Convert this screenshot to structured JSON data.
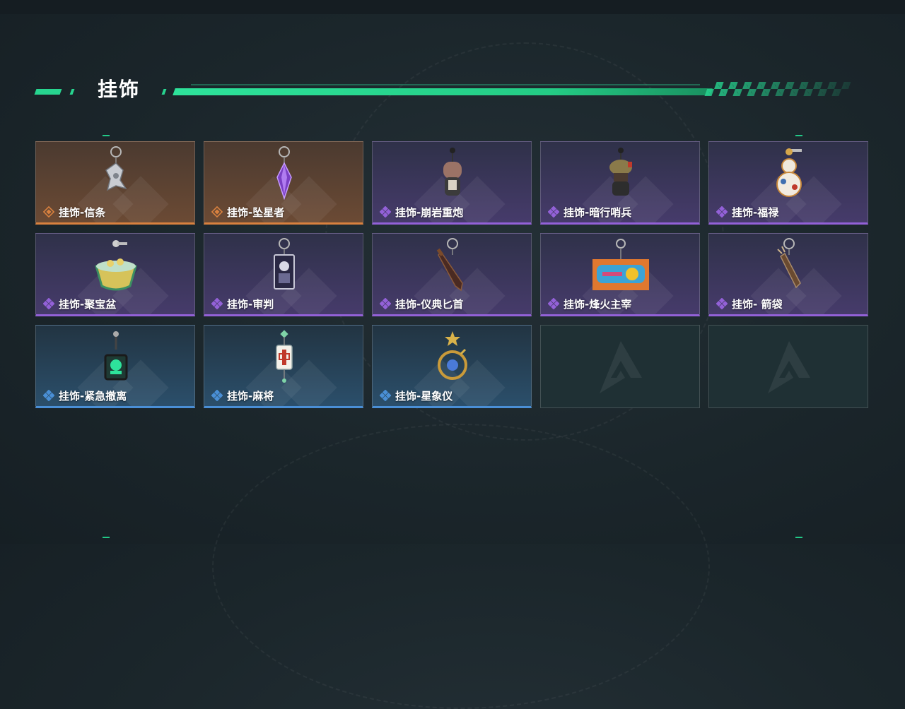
{
  "section": {
    "title": "挂饰"
  },
  "colors": {
    "accent_green": "#27d48f",
    "rarity_orange": "#d9813f",
    "rarity_purple": "#9361d8",
    "rarity_blue": "#4a8fd6"
  },
  "items": [
    {
      "name": "挂饰-信条",
      "rarity": "orange",
      "icon": "pendant-creed-icon"
    },
    {
      "name": "挂饰-坠星者",
      "rarity": "orange",
      "icon": "pendant-starfaller-crystal-icon"
    },
    {
      "name": "挂饰-崩岩重炮",
      "rarity": "purple",
      "icon": "pendant-rock-cannon-figure-icon"
    },
    {
      "name": "挂饰-暗行哨兵",
      "rarity": "purple",
      "icon": "pendant-shadow-sentinel-figure-icon"
    },
    {
      "name": "挂饰-福禄",
      "rarity": "purple",
      "icon": "pendant-gourd-icon"
    },
    {
      "name": "挂饰-聚宝盆",
      "rarity": "purple",
      "icon": "pendant-treasure-bowl-icon"
    },
    {
      "name": "挂饰-审判",
      "rarity": "purple",
      "icon": "pendant-judgment-card-icon"
    },
    {
      "name": "挂饰-仪典匕首",
      "rarity": "purple",
      "icon": "pendant-ritual-dagger-icon"
    },
    {
      "name": "挂饰-烽火主宰",
      "rarity": "purple",
      "icon": "pendant-beacon-banner-icon"
    },
    {
      "name": "挂饰- 箭袋",
      "rarity": "purple",
      "icon": "pendant-quiver-icon"
    },
    {
      "name": "挂饰-紧急撤离",
      "rarity": "blue",
      "icon": "pendant-evacuation-tag-icon"
    },
    {
      "name": "挂饰-麻将",
      "rarity": "blue",
      "icon": "pendant-mahjong-tile-icon"
    },
    {
      "name": "挂饰-星象仪",
      "rarity": "blue",
      "icon": "pendant-astrolabe-icon"
    }
  ],
  "empty_slots": 2
}
